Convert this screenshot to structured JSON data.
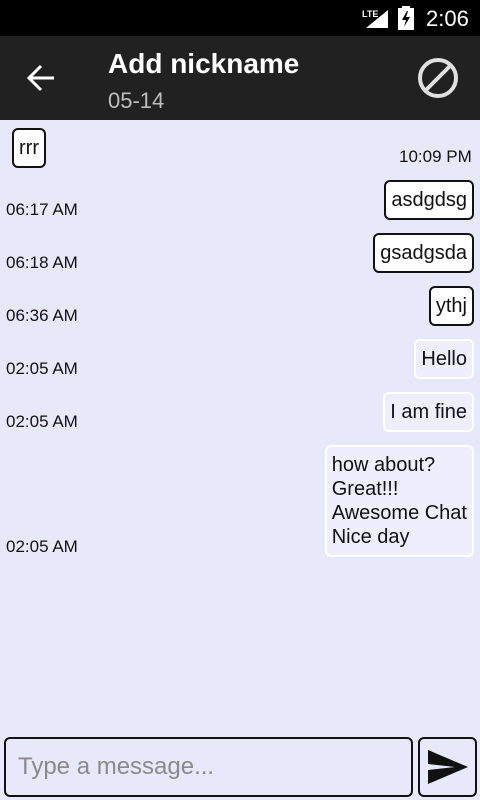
{
  "status_bar": {
    "network": "LTE",
    "time": "2:06"
  },
  "toolbar": {
    "title": "Add nickname",
    "subtitle": "05-14",
    "back_icon": "arrow-left-icon",
    "block_icon": "block-icon"
  },
  "messages": [
    {
      "text": "rrr",
      "time": "10:09 PM"
    },
    {
      "text": "asdgdsg",
      "time": "06:17 AM"
    },
    {
      "text": "gsadgsda",
      "time": "06:18 AM"
    },
    {
      "text": "ythj",
      "time": "06:36 AM"
    },
    {
      "text": "Hello",
      "time": "02:05 AM"
    },
    {
      "text": "I am fine",
      "time": "02:05 AM"
    },
    {
      "text": "how about?\nGreat!!!\nAwesome Chat\nNice day",
      "time": "02:05 AM"
    }
  ],
  "input": {
    "placeholder": "Type a message...",
    "value": ""
  },
  "send_icon": "send-icon"
}
